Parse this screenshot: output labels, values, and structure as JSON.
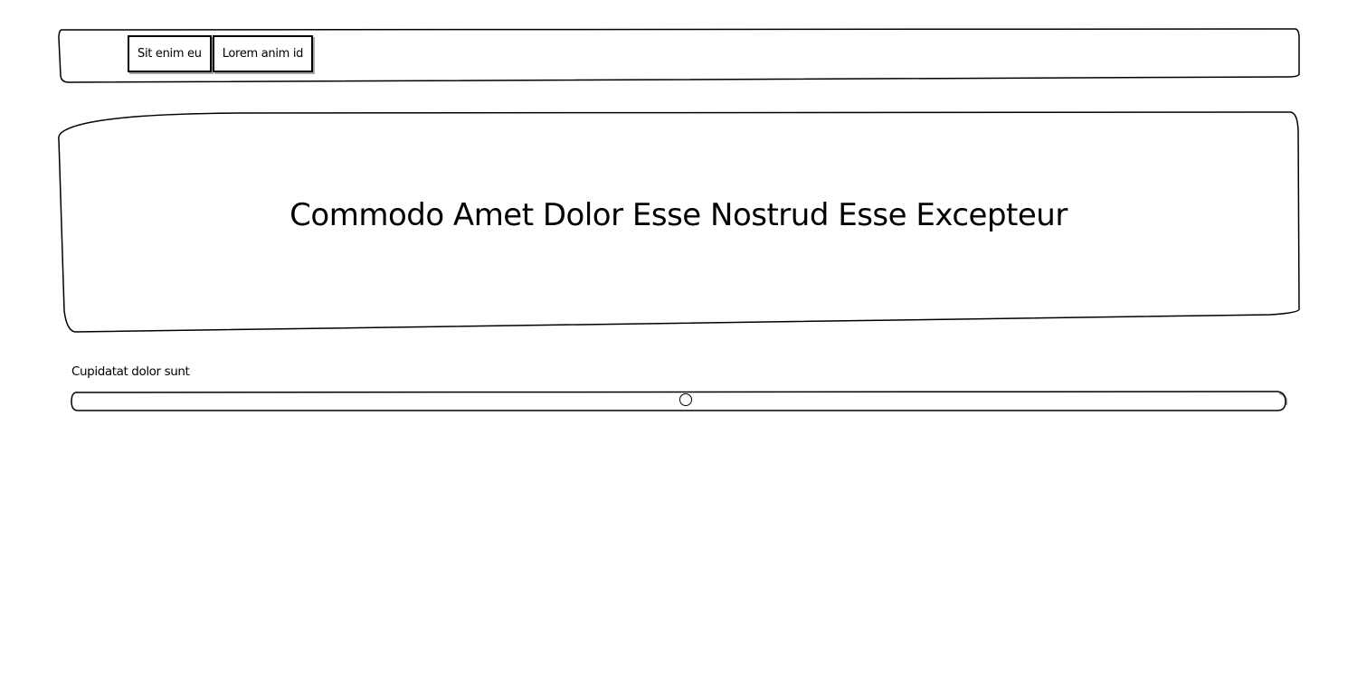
{
  "navbar": {
    "buttons": [
      {
        "label": "Sit enim eu"
      },
      {
        "label": "Lorem anim id"
      }
    ]
  },
  "hero": {
    "title": "Commodo Amet Dolor Esse Nostrud Esse Excepteur"
  },
  "slider": {
    "label": "Cupidatat dolor sunt",
    "value": 0.5,
    "min": 0,
    "max": 1
  }
}
